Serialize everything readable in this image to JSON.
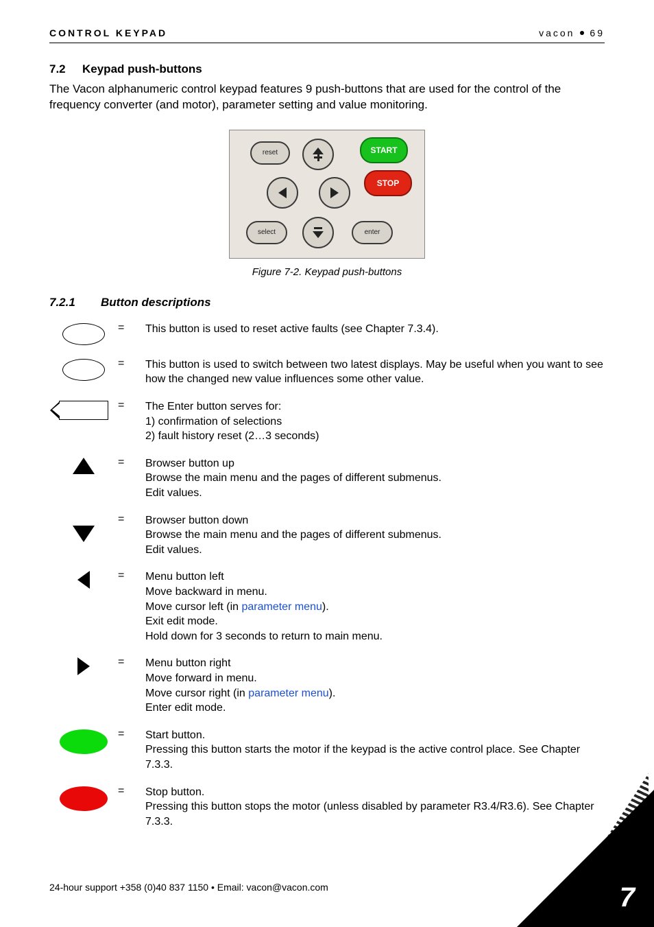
{
  "header": {
    "left": "CONTROL KEYPAD",
    "right_brand": "vacon",
    "right_page": "69"
  },
  "section": {
    "number": "7.2",
    "title": "Keypad push-buttons",
    "intro": "The Vacon alphanumeric control keypad features 9 push-buttons that are used for the control of the frequency converter (and motor), parameter setting and value monitoring."
  },
  "figure": {
    "labels": {
      "reset": "reset",
      "start": "START",
      "stop": "STOP",
      "select": "select",
      "enter": "enter"
    },
    "caption": "Figure 7-2. Keypad push-buttons"
  },
  "subsection": {
    "number": "7.2.1",
    "title": "Button descriptions"
  },
  "buttons": {
    "reset": "This button is used to reset active faults (see Chapter 7.3.4).",
    "select": "This button is used to switch between two latest displays. May be useful when you want to see how the changed new value influences some other value.",
    "enter_l1": "The Enter button serves for:",
    "enter_l2": "1) confirmation of selections",
    "enter_l3": "2) fault history reset (2…3 seconds)",
    "up_l1": "Browser button up",
    "up_l2": "Browse the main menu and the pages of different submenus.",
    "up_l3": "Edit values.",
    "down_l1": "Browser button down",
    "down_l2": "Browse the main menu and the pages of different submenus.",
    "down_l3": "Edit values.",
    "left_l1": "Menu button left",
    "left_l2": "Move backward in menu.",
    "left_l3a": "Move cursor left (in ",
    "left_l3b": "parameter menu",
    "left_l3c": ").",
    "left_l4": "Exit edit mode.",
    "left_l5": "Hold down for 3 seconds to return to main menu.",
    "right_l1": "Menu button right",
    "right_l2": "Move forward in menu.",
    "right_l3a": "Move cursor right (in ",
    "right_l3b": "parameter menu",
    "right_l3c": ").",
    "right_l4": "Enter edit mode.",
    "start_l1": "Start button.",
    "start_l2": "Pressing this button starts the motor if the keypad is the active control place. See Chapter 7.3.3.",
    "stop_l1": "Stop button.",
    "stop_l2": "Pressing this button stops the motor (unless disabled by parameter R3.4/R3.6). See Chapter 7.3.3."
  },
  "footer": "24-hour support +358 (0)40 837 1150 • Email: vacon@vacon.com",
  "pagenum": "7"
}
